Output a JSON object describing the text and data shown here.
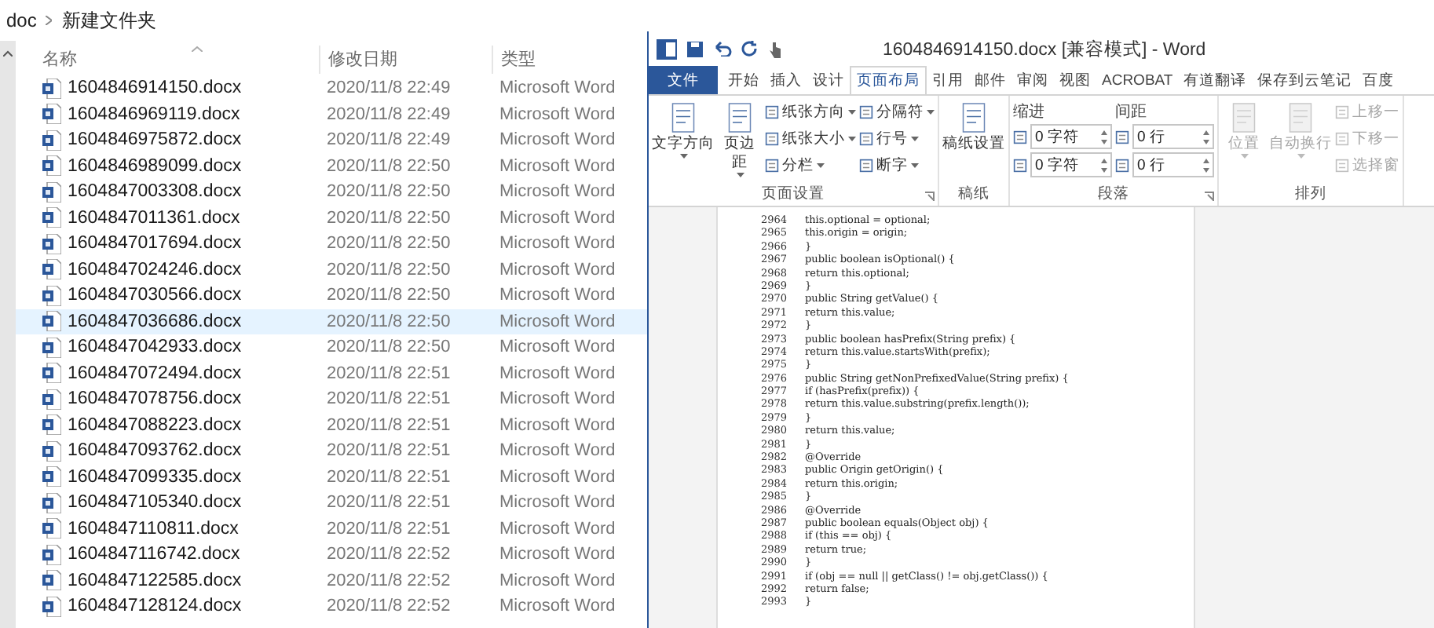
{
  "explorer": {
    "breadcrumb": [
      "doc",
      "新建文件夹"
    ],
    "columns": [
      "名称",
      "修改日期",
      "类型"
    ],
    "rows": [
      {
        "name": "1604846914150.docx",
        "date": "2020/11/8 22:49",
        "type": "Microsoft Word",
        "selected": false
      },
      {
        "name": "1604846969119.docx",
        "date": "2020/11/8 22:49",
        "type": "Microsoft Word",
        "selected": false
      },
      {
        "name": "1604846975872.docx",
        "date": "2020/11/8 22:49",
        "type": "Microsoft Word",
        "selected": false
      },
      {
        "name": "1604846989099.docx",
        "date": "2020/11/8 22:50",
        "type": "Microsoft Word",
        "selected": false
      },
      {
        "name": "1604847003308.docx",
        "date": "2020/11/8 22:50",
        "type": "Microsoft Word",
        "selected": false
      },
      {
        "name": "1604847011361.docx",
        "date": "2020/11/8 22:50",
        "type": "Microsoft Word",
        "selected": false
      },
      {
        "name": "1604847017694.docx",
        "date": "2020/11/8 22:50",
        "type": "Microsoft Word",
        "selected": false
      },
      {
        "name": "1604847024246.docx",
        "date": "2020/11/8 22:50",
        "type": "Microsoft Word",
        "selected": false
      },
      {
        "name": "1604847030566.docx",
        "date": "2020/11/8 22:50",
        "type": "Microsoft Word",
        "selected": false
      },
      {
        "name": "1604847036686.docx",
        "date": "2020/11/8 22:50",
        "type": "Microsoft Word",
        "selected": true
      },
      {
        "name": "1604847042933.docx",
        "date": "2020/11/8 22:50",
        "type": "Microsoft Word",
        "selected": false
      },
      {
        "name": "1604847072494.docx",
        "date": "2020/11/8 22:51",
        "type": "Microsoft Word",
        "selected": false
      },
      {
        "name": "1604847078756.docx",
        "date": "2020/11/8 22:51",
        "type": "Microsoft Word",
        "selected": false
      },
      {
        "name": "1604847088223.docx",
        "date": "2020/11/8 22:51",
        "type": "Microsoft Word",
        "selected": false
      },
      {
        "name": "1604847093762.docx",
        "date": "2020/11/8 22:51",
        "type": "Microsoft Word",
        "selected": false
      },
      {
        "name": "1604847099335.docx",
        "date": "2020/11/8 22:51",
        "type": "Microsoft Word",
        "selected": false
      },
      {
        "name": "1604847105340.docx",
        "date": "2020/11/8 22:51",
        "type": "Microsoft Word",
        "selected": false
      },
      {
        "name": "1604847110811.docx",
        "date": "2020/11/8 22:51",
        "type": "Microsoft Word",
        "selected": false
      },
      {
        "name": "1604847116742.docx",
        "date": "2020/11/8 22:52",
        "type": "Microsoft Word",
        "selected": false
      },
      {
        "name": "1604847122585.docx",
        "date": "2020/11/8 22:52",
        "type": "Microsoft Word",
        "selected": false
      },
      {
        "name": "1604847128124.docx",
        "date": "2020/11/8 22:52",
        "type": "Microsoft Word",
        "selected": false
      }
    ]
  },
  "word": {
    "title": "1604846914150.docx [兼容模式] - Word",
    "tabs": [
      {
        "label": "文件",
        "kind": "file"
      },
      {
        "label": "开始",
        "kind": "tab",
        "selected": false
      },
      {
        "label": "插入",
        "kind": "tab",
        "selected": false
      },
      {
        "label": "设计",
        "kind": "tab",
        "selected": false
      },
      {
        "label": "页面布局",
        "kind": "tab",
        "selected": true
      },
      {
        "label": "引用",
        "kind": "tab",
        "selected": false
      },
      {
        "label": "邮件",
        "kind": "tab",
        "selected": false
      },
      {
        "label": "审阅",
        "kind": "tab",
        "selected": false
      },
      {
        "label": "视图",
        "kind": "tab",
        "selected": false
      },
      {
        "label": "ACROBAT",
        "kind": "tab",
        "selected": false
      },
      {
        "label": "有道翻译",
        "kind": "tab",
        "selected": false
      },
      {
        "label": "保存到云笔记",
        "kind": "tab",
        "selected": false
      },
      {
        "label": "百度",
        "kind": "tab",
        "selected": false
      }
    ],
    "ribbon": [
      {
        "label": "页面设置",
        "launcher": true,
        "items": [
          {
            "kind": "large",
            "label": "文字方向",
            "dropdown": true,
            "disabled": false
          },
          {
            "kind": "large",
            "label": "页边距",
            "dropdown": true,
            "disabled": false
          },
          {
            "kind": "stack",
            "buttons": [
              {
                "label": "纸张方向",
                "dropdown": true,
                "disabled": false
              },
              {
                "label": "纸张大小",
                "dropdown": true,
                "disabled": false
              },
              {
                "label": "分栏",
                "dropdown": true,
                "disabled": false
              }
            ]
          },
          {
            "kind": "stack",
            "buttons": [
              {
                "label": "分隔符",
                "dropdown": true,
                "disabled": false
              },
              {
                "label": "行号",
                "dropdown": true,
                "disabled": false
              },
              {
                "label": "断字",
                "dropdown": true,
                "disabled": false
              }
            ]
          }
        ]
      },
      {
        "label": "稿纸",
        "launcher": false,
        "items": [
          {
            "kind": "large",
            "label": "稿纸设置",
            "dropdown": false,
            "disabled": false
          }
        ]
      },
      {
        "label": "段落",
        "launcher": true,
        "items": [
          {
            "kind": "spinners",
            "heading": "缩进",
            "fields": [
              {
                "value": "0 字符"
              },
              {
                "value": "0 字符"
              }
            ]
          },
          {
            "kind": "spinners",
            "heading": "间距",
            "fields": [
              {
                "value": "0 行"
              },
              {
                "value": "0 行"
              }
            ]
          }
        ]
      },
      {
        "label": "排列",
        "launcher": false,
        "items": [
          {
            "kind": "large",
            "label": "位置",
            "dropdown": true,
            "disabled": true
          },
          {
            "kind": "large",
            "label": "自动换行",
            "dropdown": true,
            "disabled": true
          },
          {
            "kind": "stack",
            "buttons": [
              {
                "label": "上移一",
                "dropdown": false,
                "disabled": true
              },
              {
                "label": "下移一",
                "dropdown": false,
                "disabled": true
              },
              {
                "label": "选择窗",
                "dropdown": false,
                "disabled": true
              }
            ]
          }
        ]
      }
    ],
    "document": {
      "lines": [
        {
          "number": "2964",
          "code": "this.optional = optional;"
        },
        {
          "number": "2965",
          "code": "this.origin = origin;"
        },
        {
          "number": "2966",
          "code": "}"
        },
        {
          "number": "2967",
          "code": "public boolean isOptional() {"
        },
        {
          "number": "2968",
          "code": "return this.optional;"
        },
        {
          "number": "2969",
          "code": "}"
        },
        {
          "number": "2970",
          "code": "public String getValue() {"
        },
        {
          "number": "2971",
          "code": "return this.value;"
        },
        {
          "number": "2972",
          "code": "}"
        },
        {
          "number": "2973",
          "code": "public boolean hasPrefix(String prefix) {"
        },
        {
          "number": "2974",
          "code": "return this.value.startsWith(prefix);"
        },
        {
          "number": "2975",
          "code": "}"
        },
        {
          "number": "2976",
          "code": "public String getNonPrefixedValue(String prefix) {"
        },
        {
          "number": "2977",
          "code": "if (hasPrefix(prefix)) {"
        },
        {
          "number": "2978",
          "code": "return this.value.substring(prefix.length());"
        },
        {
          "number": "2979",
          "code": "}"
        },
        {
          "number": "2980",
          "code": "return this.value;"
        },
        {
          "number": "2981",
          "code": "}"
        },
        {
          "number": "2982",
          "code": "@Override"
        },
        {
          "number": "2983",
          "code": "public Origin getOrigin() {"
        },
        {
          "number": "2984",
          "code": "return this.origin;"
        },
        {
          "number": "2985",
          "code": "}"
        },
        {
          "number": "2986",
          "code": "@Override"
        },
        {
          "number": "2987",
          "code": "public boolean equals(Object obj) {"
        },
        {
          "number": "2988",
          "code": "if (this == obj) {"
        },
        {
          "number": "2989",
          "code": "return true;"
        },
        {
          "number": "2990",
          "code": "}"
        },
        {
          "number": "2991",
          "code": "if (obj == null || getClass() != obj.getClass()) {"
        },
        {
          "number": "2992",
          "code": "return false;"
        },
        {
          "number": "2993",
          "code": "}"
        }
      ]
    }
  }
}
